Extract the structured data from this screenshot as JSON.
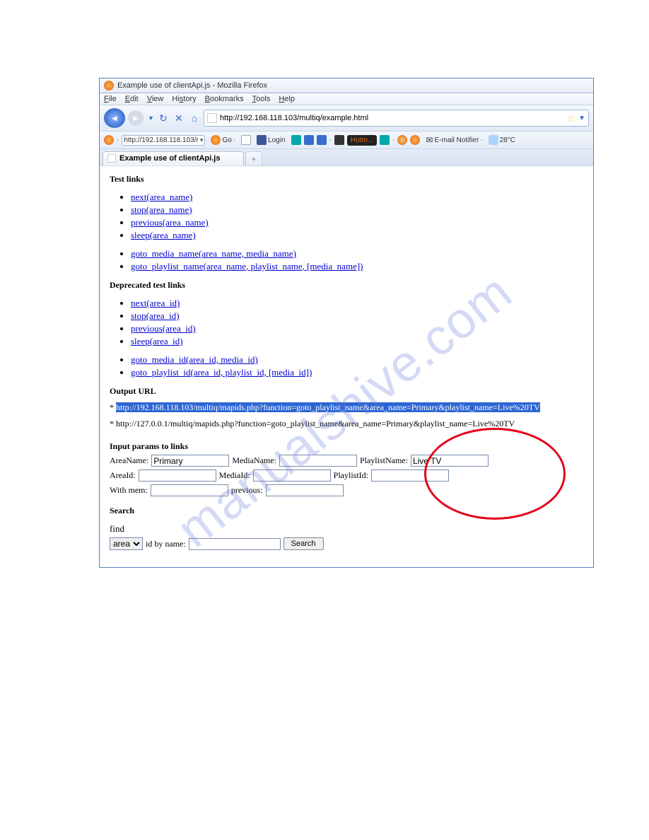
{
  "window": {
    "title": "Example use of clientApi.js - Mozilla Firefox"
  },
  "menu": {
    "file": "File",
    "edit": "Edit",
    "view": "View",
    "history": "History",
    "bookmarks": "Bookmarks",
    "tools": "Tools",
    "help": "Help"
  },
  "address": {
    "url": "http://192.168.118.103/multiq/example.html"
  },
  "bookmarkbar": {
    "selector": "http://192.168.118.103/r",
    "go": "Go",
    "login": "Login",
    "hotmail": "Hotm...",
    "email": "E-mail Notifier",
    "temp": "28°C"
  },
  "tab": {
    "title": "Example use of clientApi.js"
  },
  "content": {
    "testlinks": {
      "heading": "Test links",
      "items1": {
        "next": "next(area_name)",
        "stop": "stop(area_name)",
        "previous": "previous(area_name)",
        "sleep": "sleep(area_name)"
      },
      "items2": {
        "gotoMedia": "goto_media_name(area_name, media_name)",
        "gotoPlaylist": "goto_playlist_name(area_name, playlist_name, [media_name])"
      }
    },
    "deprecated": {
      "heading": "Deprecated test links",
      "items1": {
        "next": "next(area_id)",
        "stop": "stop(area_id)",
        "previous": "previous(area_id)",
        "sleep": "sleep(area_id)"
      },
      "items2": {
        "gotoMedia": "goto_media_id(area_id, media_id)",
        "gotoPlaylist": "goto_playlist_id(area_id, playlist_id, [media_id])"
      }
    },
    "output": {
      "heading": "Output URL",
      "url1": "http://192.168.118.103/multiq/mapids.php?function=goto_playlist_name&area_name=Primary&playlist_name=Live%20TV",
      "url2": "* http://127.0.0.1/multiq/mapids.php?function=goto_playlist_name&area_name=Primary&playlist_name=Live%20TV"
    },
    "params": {
      "heading": "Input params to links",
      "areaNameLabel": "AreaName:",
      "areaNameValue": "Primary",
      "mediaNameLabel": "MediaName:",
      "mediaNameValue": "",
      "playlistNameLabel": "PlaylistName:",
      "playlistNameValue": "Live TV",
      "areaIdLabel": "AreaId:",
      "mediaIdLabel": "MediaId:",
      "playlistIdLabel": "PlaylistId:",
      "withMemLabel": "With mem:",
      "previousLabel": "previous:"
    },
    "search": {
      "heading": "Search",
      "findLabel": "find",
      "selectValue": "area",
      "idByName": "id by name:",
      "button": "Search"
    }
  },
  "watermark": "manualshive.com"
}
